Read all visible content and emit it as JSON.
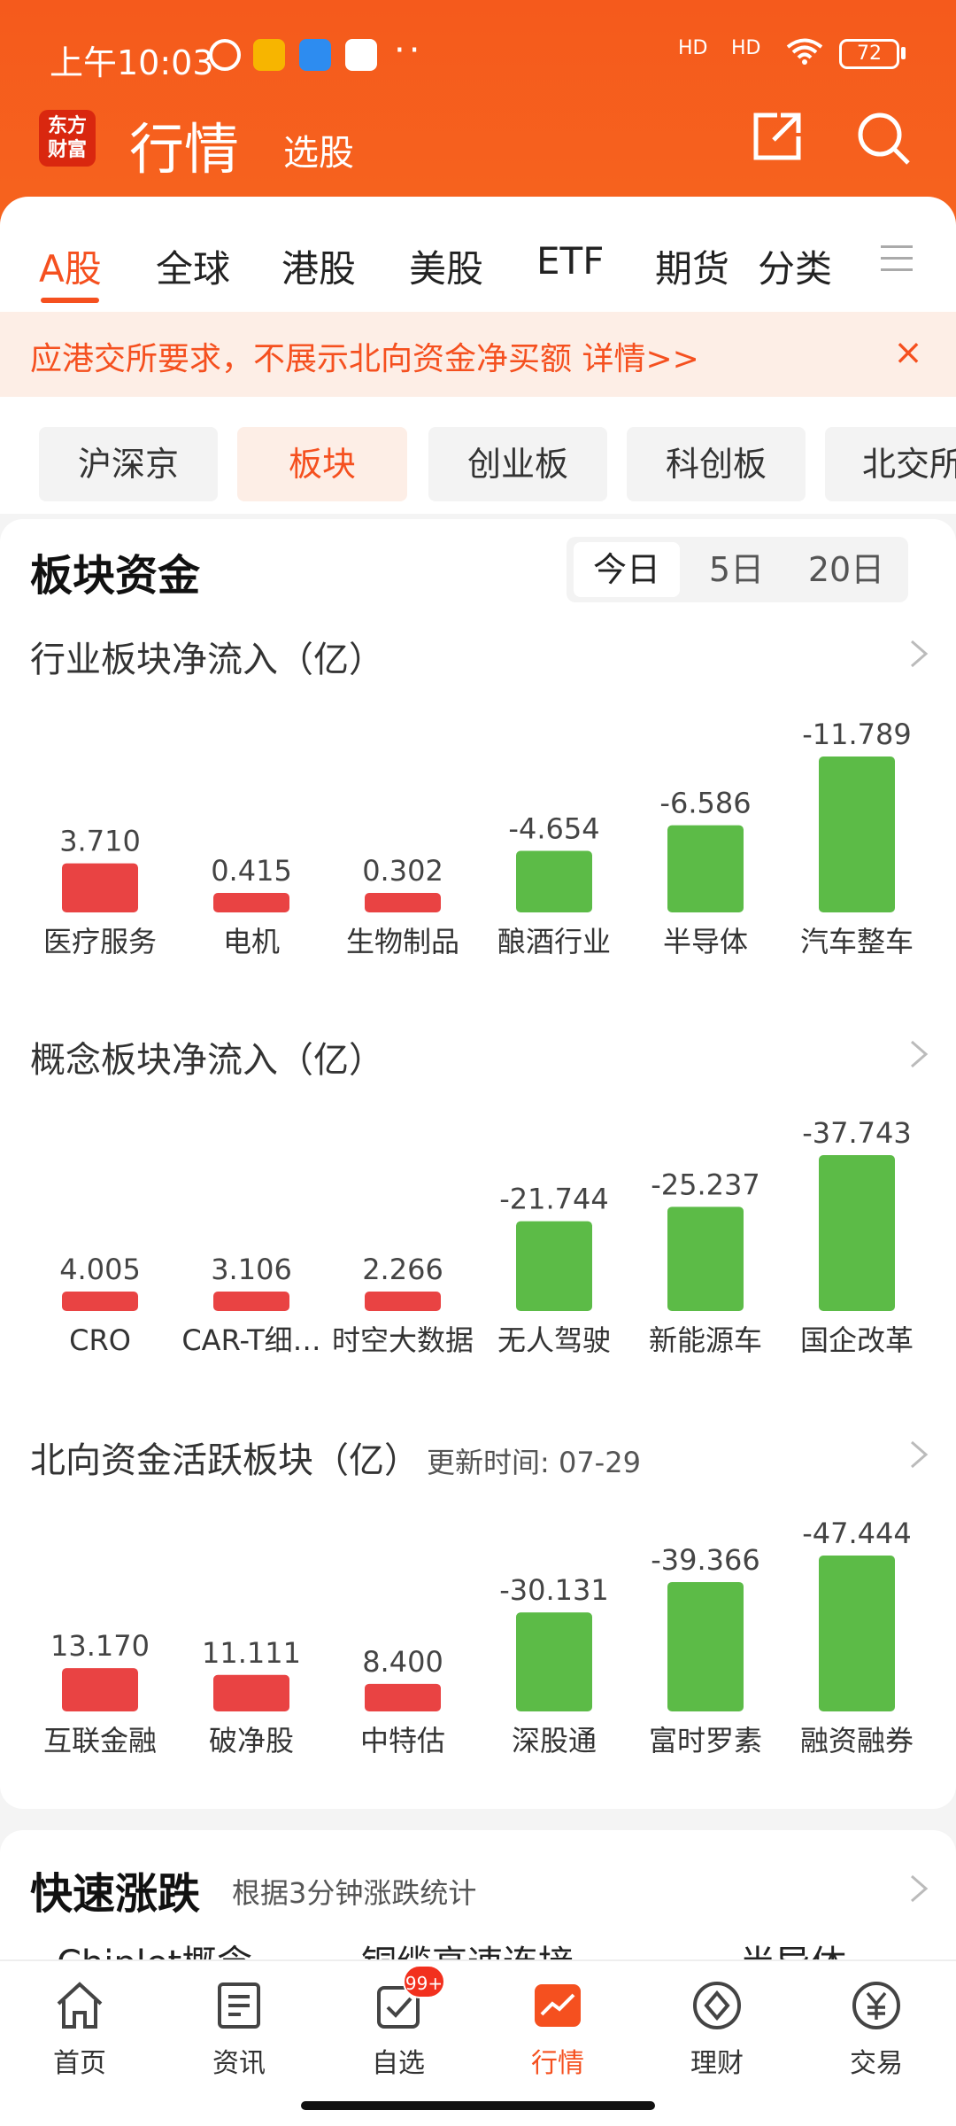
{
  "status_bar": {
    "time": "上午10:03",
    "extra": "··",
    "signal_1": "HD",
    "signal_2": "HD",
    "battery": "72"
  },
  "header": {
    "logo": "东方\n财富",
    "title": "行情",
    "tab_select": "选股"
  },
  "market_tabs": [
    "A股",
    "全球",
    "港股",
    "美股",
    "ETF",
    "期货",
    "分类"
  ],
  "notice": {
    "text": "应港交所要求，不展示北向资金净买额 详情>>",
    "close": "×"
  },
  "sub_tabs": [
    "沪深京",
    "板块",
    "创业板",
    "科创板",
    "北交所"
  ],
  "fund_section": {
    "title": "板块资金",
    "periods": [
      "今日",
      "5日",
      "20日"
    ]
  },
  "colors": {
    "brand": "#f5501f",
    "up_red": "#e94343",
    "down_green": "#5cbb47"
  },
  "chart_data": [
    {
      "type": "bar",
      "title": "行业板块净流入（亿）",
      "categories": [
        "医疗服务",
        "电机",
        "生物制品",
        "酿酒行业",
        "半导体",
        "汽车整车"
      ],
      "values": [
        3.71,
        0.415,
        0.302,
        -4.654,
        -6.586,
        -11.789
      ],
      "labels": [
        "3.710",
        "0.415",
        "0.302",
        "-4.654",
        "-6.586",
        "-11.789"
      ]
    },
    {
      "type": "bar",
      "title": "概念板块净流入（亿）",
      "categories": [
        "CRO",
        "CAR-T细…",
        "时空大数据",
        "无人驾驶",
        "新能源车",
        "国企改革"
      ],
      "values": [
        4.005,
        3.106,
        2.266,
        -21.744,
        -25.237,
        -37.743
      ],
      "labels": [
        "4.005",
        "3.106",
        "2.266",
        "-21.744",
        "-25.237",
        "-37.743"
      ]
    },
    {
      "type": "bar",
      "title": "北向资金活跃板块（亿）",
      "subtitle": "更新时间: 07-29",
      "categories": [
        "互联金融",
        "破净股",
        "中特估",
        "深股通",
        "富时罗素",
        "融资融券"
      ],
      "values": [
        13.17,
        11.111,
        8.4,
        -30.131,
        -39.366,
        -47.444
      ],
      "labels": [
        "13.170",
        "11.111",
        "8.400",
        "-30.131",
        "-39.366",
        "-47.444"
      ]
    }
  ],
  "quick_move": {
    "title": "快速涨跌",
    "subtitle": "根据3分钟涨跌统计",
    "peek": [
      "Chiplet概念",
      "铜缆高速连接",
      "半导体"
    ]
  },
  "bottom_nav": {
    "items": [
      {
        "label": "首页",
        "icon": "home-icon"
      },
      {
        "label": "资讯",
        "icon": "news-icon"
      },
      {
        "label": "自选",
        "icon": "watchlist-icon"
      },
      {
        "label": "行情",
        "icon": "market-chart-icon"
      },
      {
        "label": "理财",
        "icon": "wealth-icon"
      },
      {
        "label": "交易",
        "icon": "trade-icon"
      }
    ],
    "badge": "99+"
  }
}
